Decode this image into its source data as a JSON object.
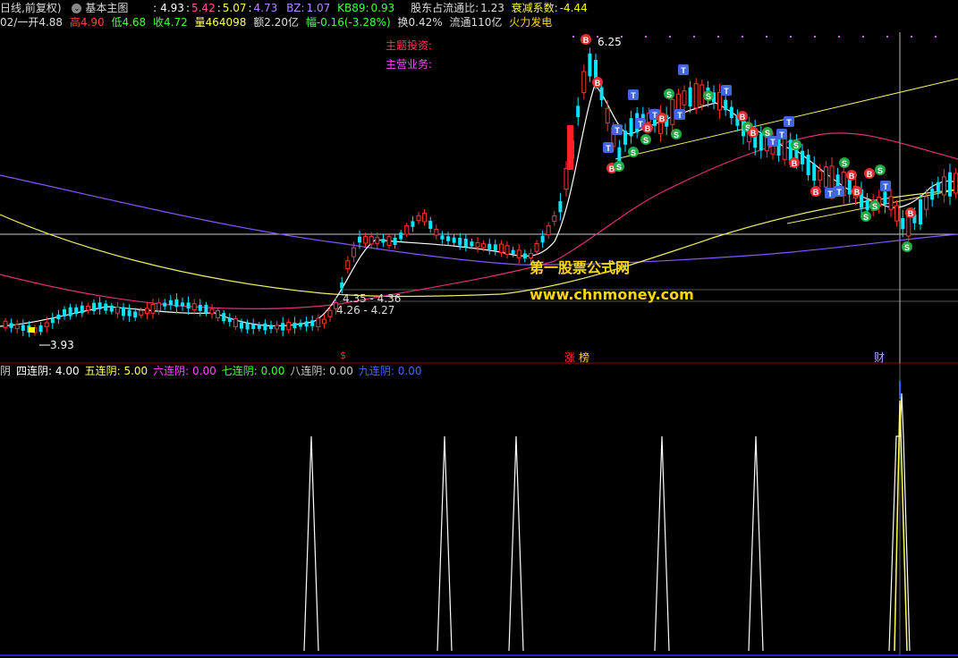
{
  "header1": {
    "period": "日线,前复权)",
    "template": "基本主图",
    "ma_values": [
      {
        "v": "4.93",
        "c": "#ffffff"
      },
      {
        "v": "5.42",
        "c": "#ff4fa0"
      },
      {
        "v": "5.07",
        "c": "#ffff55"
      },
      {
        "v": "4.73",
        "c": "#b388ff"
      }
    ],
    "bz_label": "BZ:",
    "bz": "1.07",
    "kb_label": "KB89:",
    "kb": "0.93",
    "holder_label": "股东占流通比:",
    "holder": "1.23",
    "decay_label": "衰减系数:",
    "decay": "-4.44"
  },
  "header2": {
    "date": "02/一",
    "open_label": "开",
    "open": "4.88",
    "high_label": "高",
    "high": "4.90",
    "low_label": "低",
    "low": "4.68",
    "close_label": "收",
    "close": "4.72",
    "vol_label": "量",
    "vol": "464098",
    "amt_label": "额",
    "amt": "2.20亿",
    "chg_label": "幅",
    "chg": "-0.16(-3.28%)",
    "turn_label": "换",
    "turn": "0.42%",
    "float_label": "流通",
    "float": "110亿",
    "concept": "火力发电"
  },
  "header3": {
    "items": [
      {
        "label": "阴",
        "value": "",
        "c": "#cfcfcf"
      },
      {
        "label": "四连阴:",
        "value": "4.00",
        "c": "#ffffff"
      },
      {
        "label": "五连阴:",
        "value": "5.00",
        "c": "#ffff55"
      },
      {
        "label": "六连阴:",
        "value": "0.00",
        "c": "#ff44ff"
      },
      {
        "label": "七连阴:",
        "value": "0.00",
        "c": "#44ff44"
      },
      {
        "label": "八连阴:",
        "value": "0.00",
        "c": "#cccccc"
      },
      {
        "label": "九连阴:",
        "value": "0.00",
        "c": "#4466ff"
      }
    ]
  },
  "annotations": {
    "theme_invest": "主题投资:",
    "main_business": "主营业务:",
    "peak_price": "6.25",
    "low_price": "3.93",
    "range1": "4.35 - 4.36",
    "range2": "4.26 - 4.27",
    "marker_s": "$",
    "marker_zhang": "涨",
    "marker_bang": "榜",
    "marker_cai": "财"
  },
  "watermark": {
    "line1": "第一股票公式网",
    "line2": "www.chnmoney.com"
  },
  "colors": {
    "up": "#ff3333",
    "down": "#00e5ff",
    "ma_white": "#ffffff",
    "ma_pink": "#ff4fa0",
    "ma_yellow": "#ffff55",
    "ma_purple": "#9966ff",
    "grid_red": "#8b0000",
    "signal_b": "#e03030",
    "signal_s": "#22aa44",
    "signal_t": "#4466dd"
  }
}
